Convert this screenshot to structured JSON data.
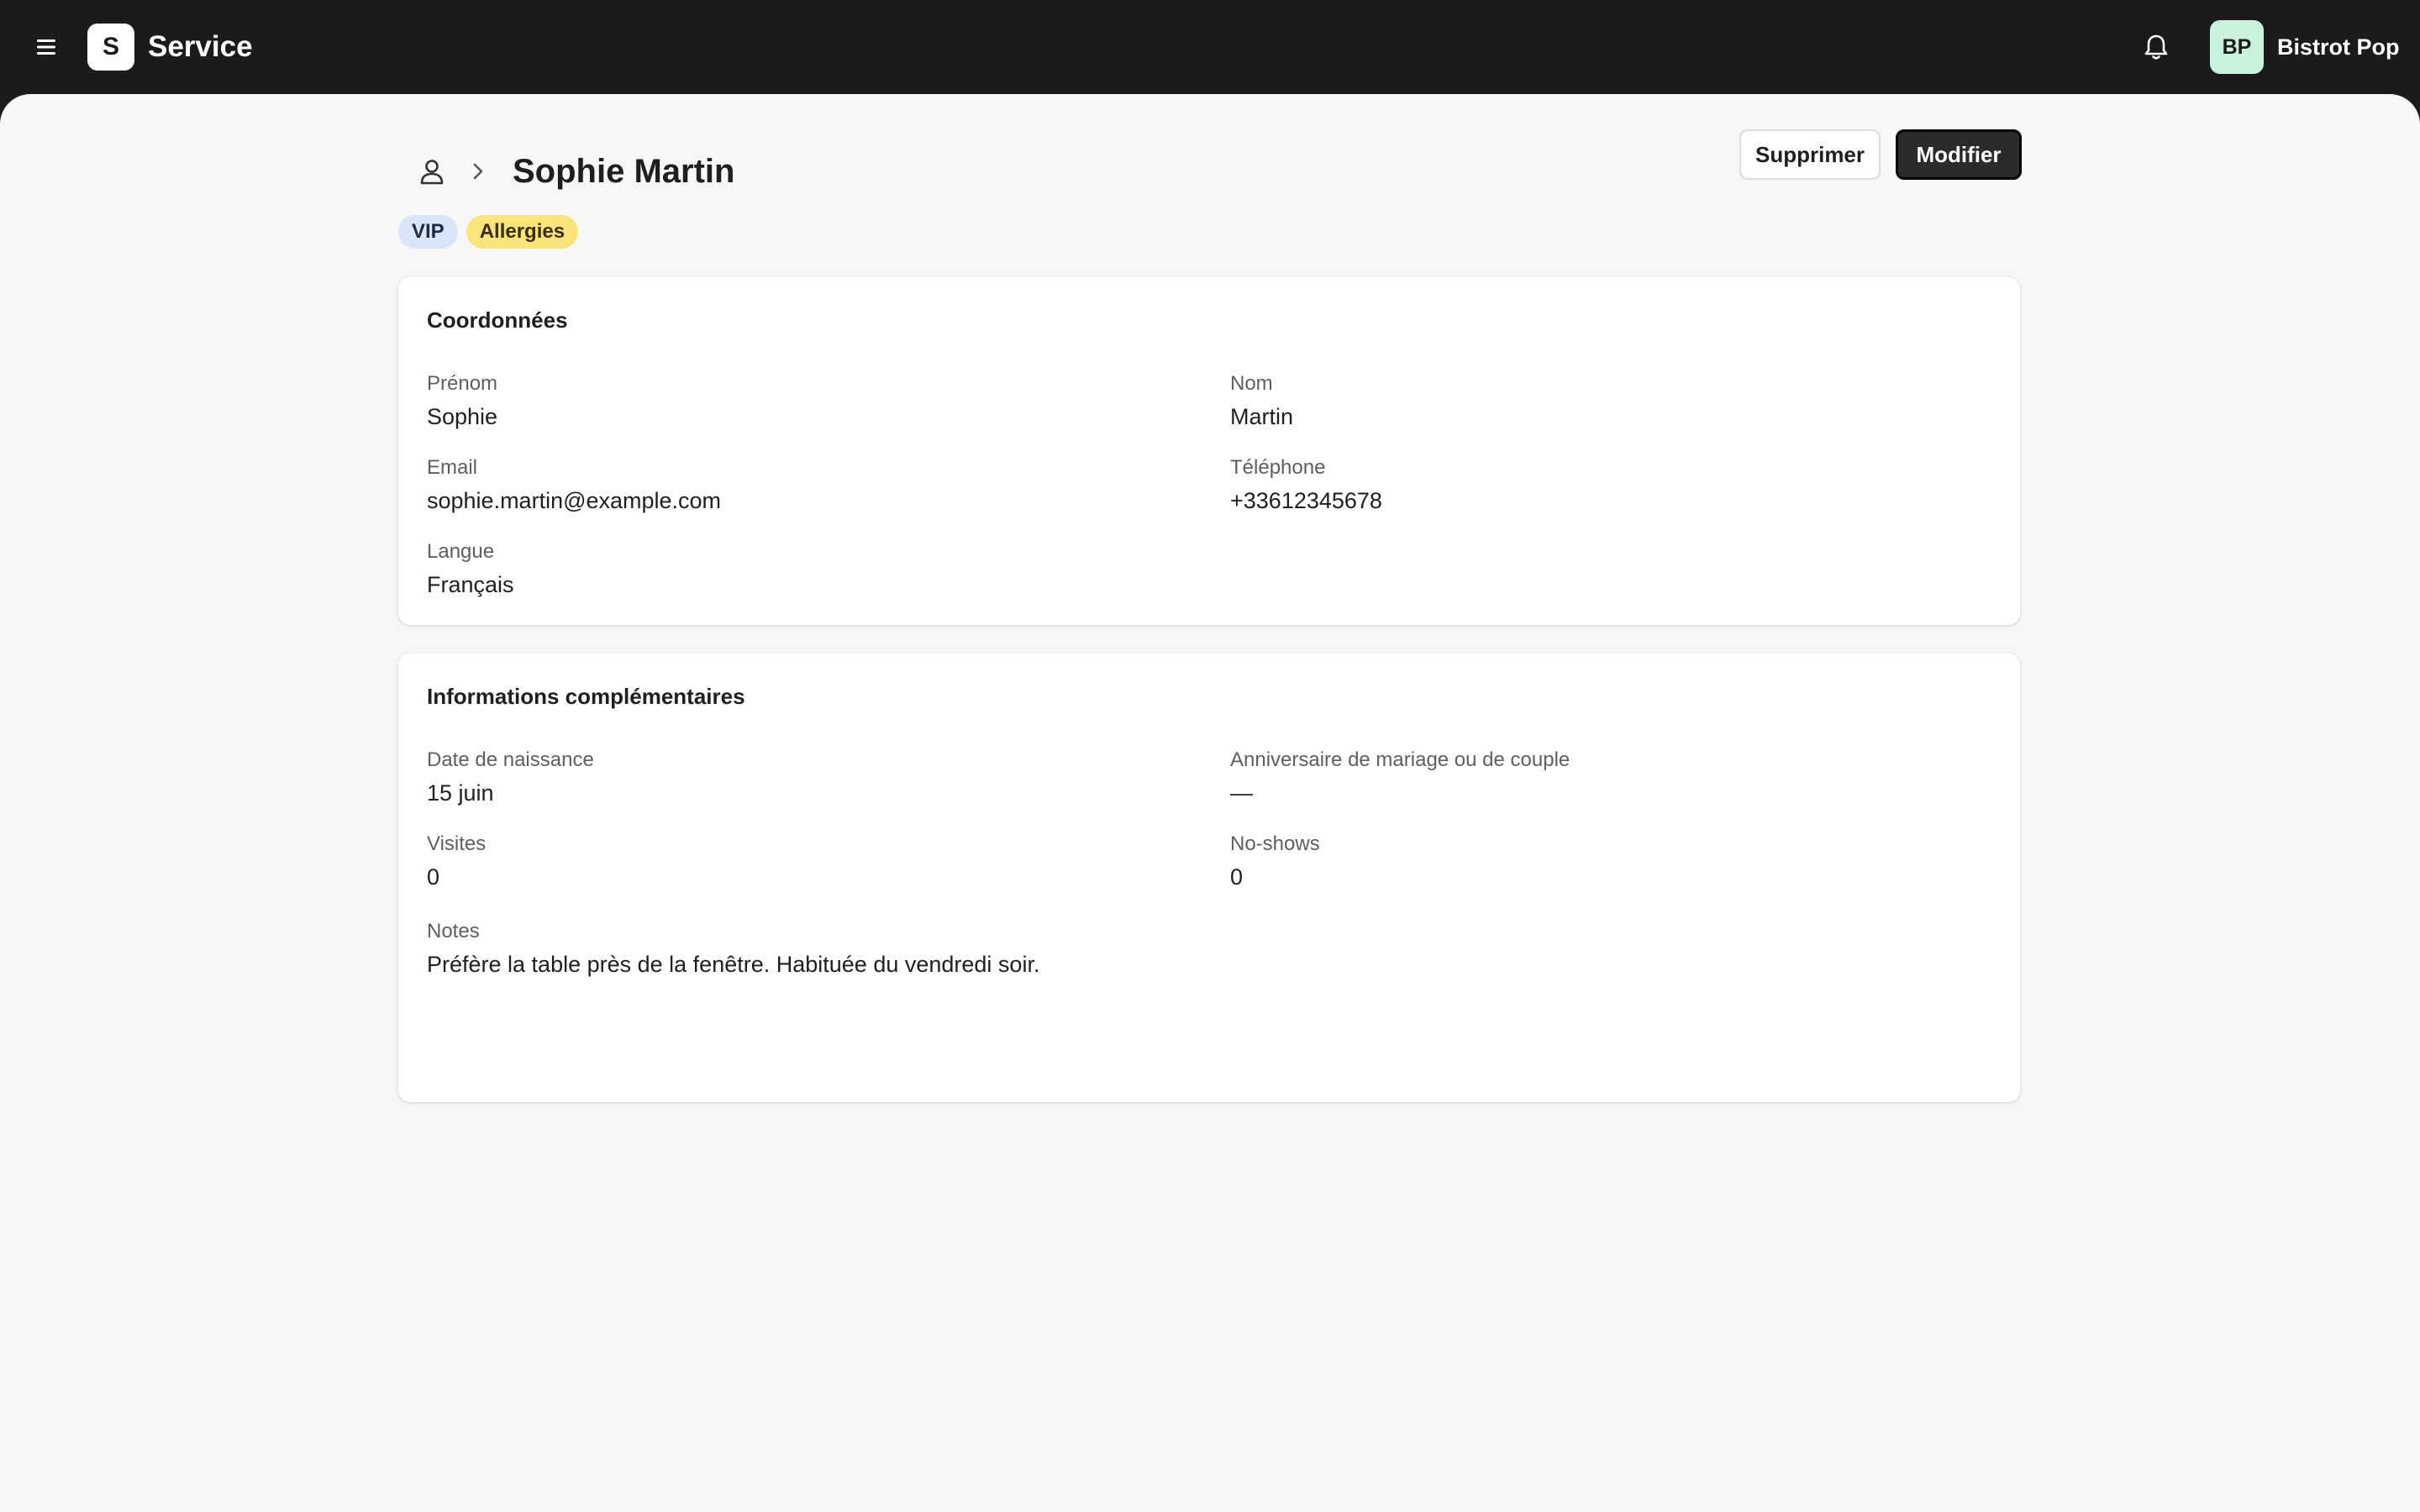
{
  "app": {
    "logo_letter": "S",
    "title": "Service",
    "restaurant_initials": "BP",
    "restaurant_name": "Bistrot Pop"
  },
  "icons": {
    "menu": "hamburger-icon",
    "bell": "bell-icon",
    "user": "user-icon",
    "chevron": "chevron-right-icon"
  },
  "page": {
    "title": "Sophie Martin",
    "delete_label": "Supprimer",
    "edit_label": "Modifier",
    "tags": [
      {
        "label": "VIP",
        "color": "#d9e5fb"
      },
      {
        "label": "Allergies",
        "color": "#fbe57a"
      }
    ]
  },
  "contact": {
    "title": "Coordonnées",
    "first_name": {
      "label": "Prénom",
      "value": "Sophie"
    },
    "last_name": {
      "label": "Nom",
      "value": "Martin"
    },
    "email": {
      "label": "Email",
      "value": "sophie.martin@example.com"
    },
    "phone": {
      "label": "Téléphone",
      "value": "+33612345678"
    },
    "language": {
      "label": "Langue",
      "value": "Français"
    }
  },
  "extra": {
    "title": "Informations complémentaires",
    "birthday": {
      "label": "Date de naissance",
      "value": "15 juin"
    },
    "anniversary": {
      "label": "Anniversaire de mariage ou de couple",
      "value": "—"
    },
    "visits": {
      "label": "Visites",
      "value": "0"
    },
    "no_shows": {
      "label": "No-shows",
      "value": "0"
    },
    "notes": {
      "label": "Notes",
      "value": "Préfère la table près de la fenêtre. Habituée du vendredi soir."
    }
  },
  "colors": {
    "topbar": "#1b1b1b",
    "background": "#f7f7f7",
    "primary_button": "#2b2b2b",
    "avatar": "#c9f2dc"
  }
}
